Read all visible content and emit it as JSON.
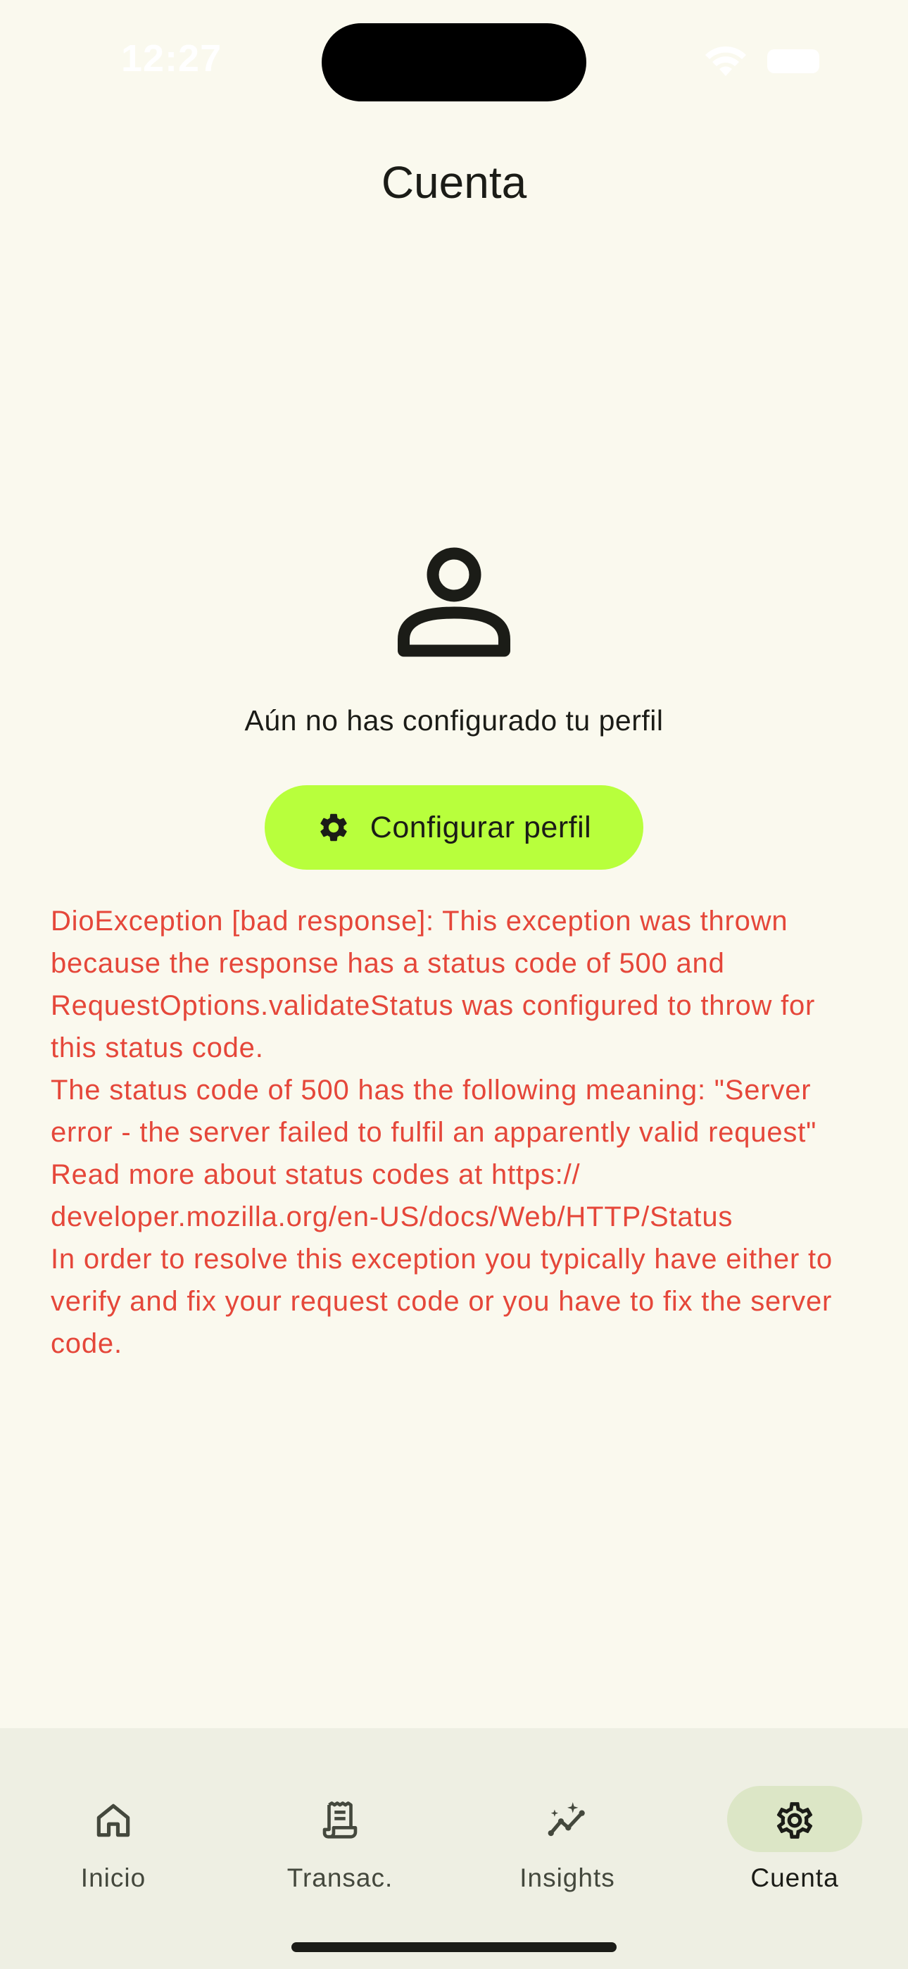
{
  "status_bar": {
    "time": "12:27"
  },
  "header": {
    "title": "Cuenta"
  },
  "profile": {
    "icon": "person-outline-icon",
    "empty_message": "Aún no has configurado tu perfil",
    "configure_button_label": "Configurar perfil",
    "configure_button_icon": "gear-icon"
  },
  "error": {
    "message": "DioException [bad response]: This exception was thrown because the response has a status code of 500 and RequestOptions.validateStatus was configured to throw for this status code.\nThe status code of 500 has the following meaning: \"Server error - the server failed to fulfil an apparently valid request\"\nRead more about status codes at https:// developer.mozilla.org/en-US/docs/Web/HTTP/Status\nIn order to resolve this exception you typically have either to verify and fix your request code or you have to fix the server code."
  },
  "bottom_nav": {
    "items": [
      {
        "label": "Inicio",
        "icon": "home-icon",
        "active": false
      },
      {
        "label": "Transac.",
        "icon": "receipt-icon",
        "active": false
      },
      {
        "label": "Insights",
        "icon": "insights-icon",
        "active": false
      },
      {
        "label": "Cuenta",
        "icon": "settings-icon",
        "active": true
      }
    ]
  },
  "colors": {
    "background": "#FAF9EE",
    "accent_button": "#B8FF3C",
    "error_text": "#E5473A",
    "nav_background": "#EEEFE3",
    "nav_active_pill": "#DCE6C6"
  }
}
